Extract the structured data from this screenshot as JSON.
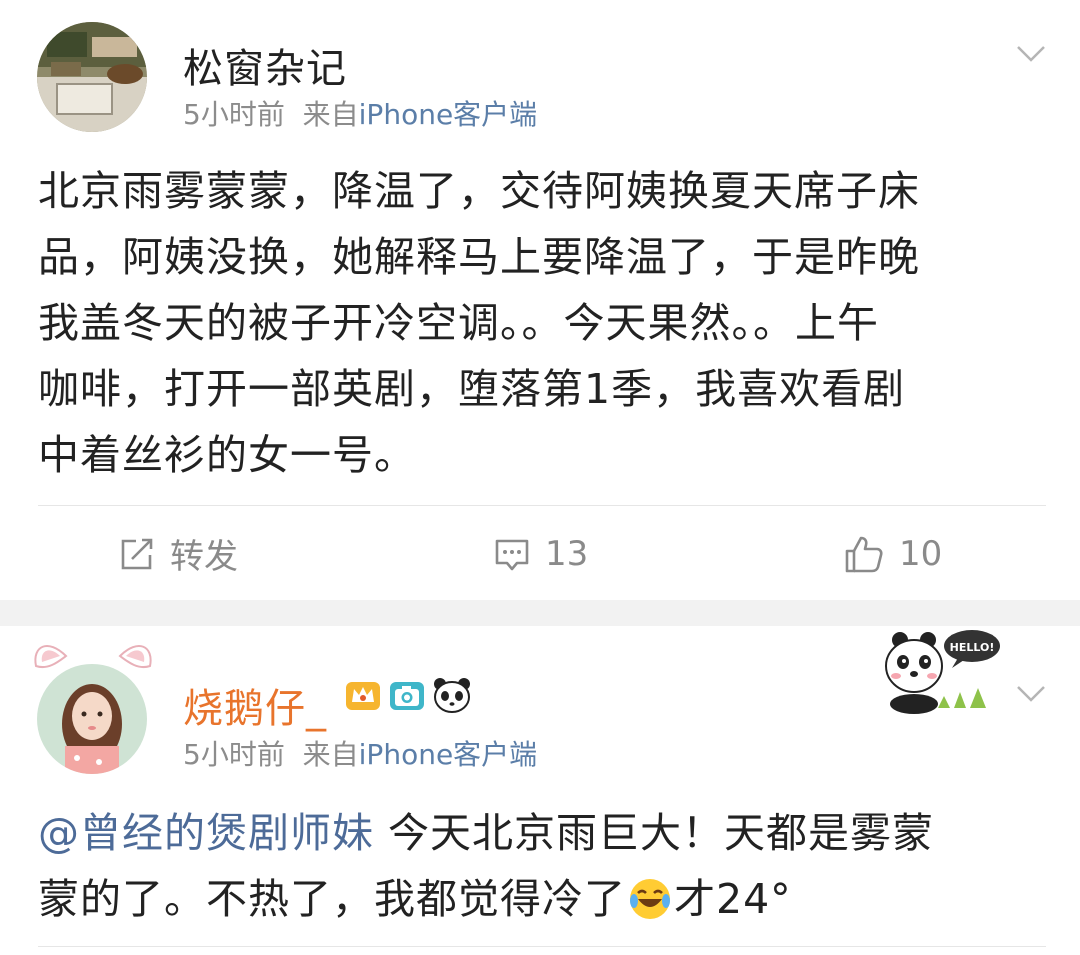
{
  "posts": [
    {
      "username": "松窗杂记",
      "time": "5小时前",
      "source_prefix": "来自",
      "source": "iPhone客户端",
      "content_lines": [
        "北京雨雾蒙蒙，降温了，交待阿姨换夏天席子床",
        "品，阿姨没换，她解释马上要降温了，于是昨晚",
        "我盖冬天的被子开冷空调。。今天果然。。上午",
        "咖啡，打开一部英剧，堕落第1季，我喜欢看剧",
        "中着丝衫的女一号。"
      ],
      "actions": {
        "repost_label": "转发",
        "comments_count": "13",
        "likes_count": "10"
      }
    },
    {
      "username": "烧鹅仔_",
      "time": "5小时前",
      "source_prefix": "来自",
      "source": "iPhone客户端",
      "mention": "@曾经的煲剧师妹",
      "content_line1_rest": " 今天北京雨巨大！天都是雾蒙",
      "content_line2_before_emoji": "蒙的了。不热了，我都觉得冷了",
      "content_line2_after_emoji": "才24°",
      "sticker_text": "HELLO!",
      "icons": [
        "crown-badge-icon",
        "camera-badge-icon",
        "panda-badge-icon",
        "laughing-tears-emoji-icon"
      ]
    }
  ],
  "colors": {
    "username2": "#e8742c",
    "link": "#4d6b98",
    "meta": "#8c8c8c",
    "separator": "#f2f2f2"
  }
}
